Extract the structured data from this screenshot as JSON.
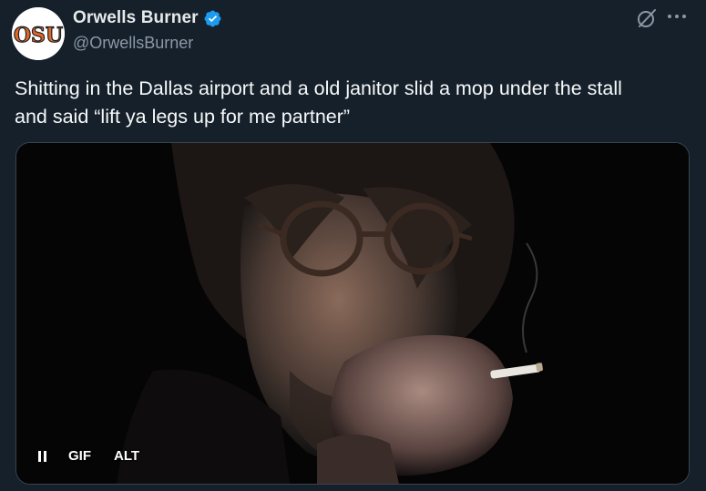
{
  "author": {
    "display_name": "Orwells Burner",
    "handle": "@OrwellsBurner",
    "verified": true,
    "avatar_logo": "OSU"
  },
  "icons": {
    "grok": "grok-icon",
    "more": "more-options-icon",
    "verified": "verified-badge-icon",
    "pause": "pause-icon"
  },
  "tweet": {
    "text": "Shitting in the Dallas airport and a old janitor slid a mop under the stall\nand said “lift ya legs up for me partner”"
  },
  "media": {
    "type_badge": "GIF",
    "alt_badge": "ALT",
    "description": "Man with round glasses smoking a cigarette in a dark room"
  },
  "colors": {
    "background": "#15202b",
    "text": "#f7f9f9",
    "secondary": "#8b98a5",
    "verified": "#1d9bf0",
    "avatar_accent": "#e2652a"
  }
}
